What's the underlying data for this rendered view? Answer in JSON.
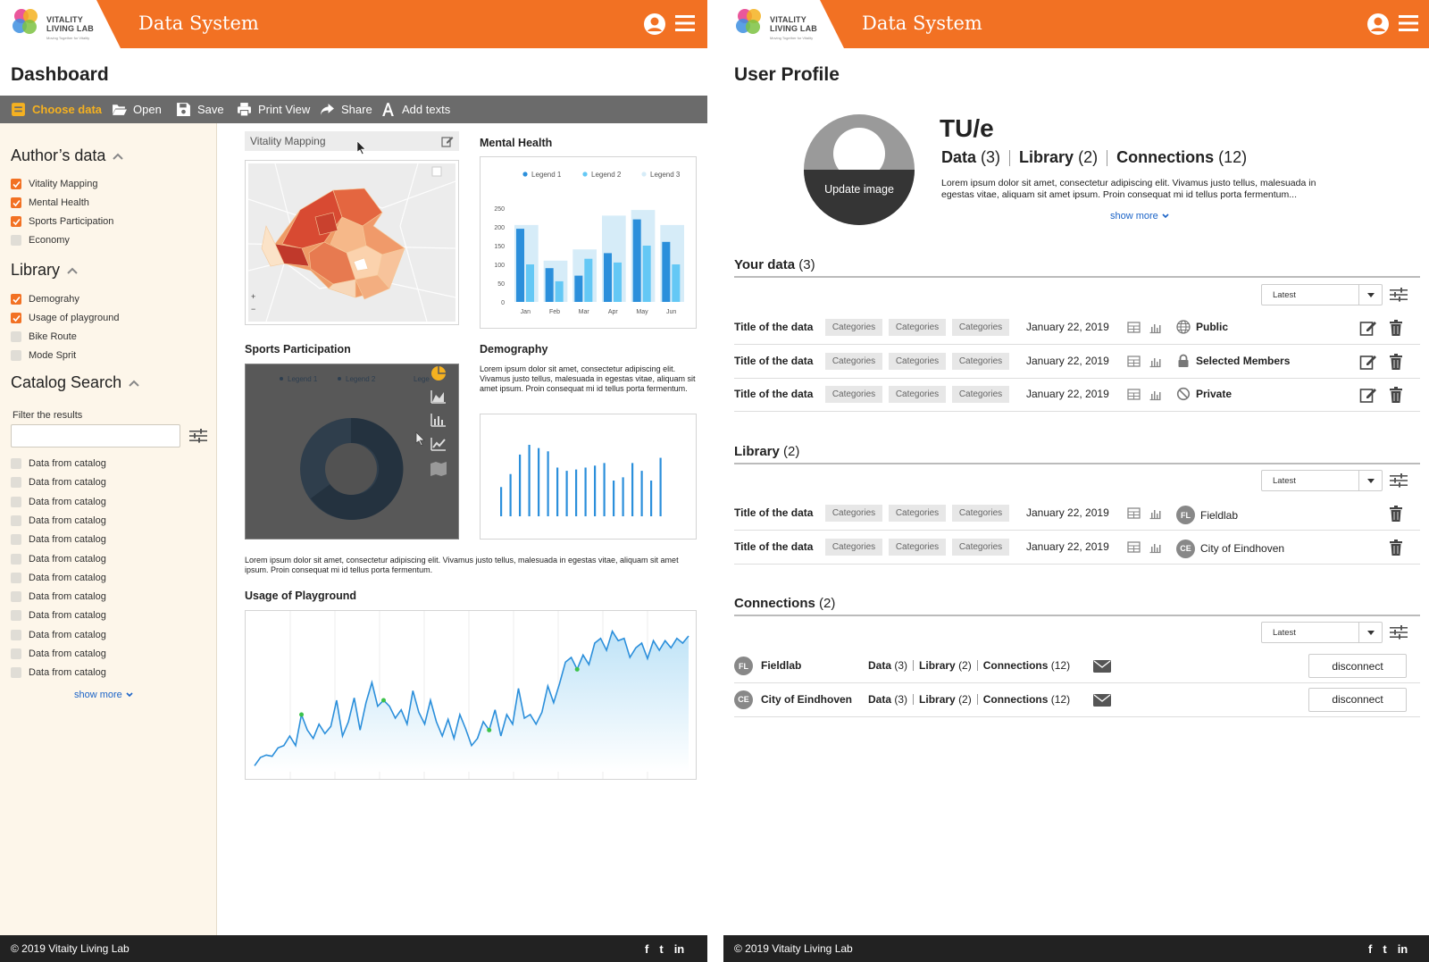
{
  "colors": {
    "brand": "#f27123",
    "toolbar": "#6b6b6b",
    "sidebar": "#fdf6ea",
    "chart_blue": "#2b8fdb",
    "chart_light": "#64c8f5",
    "footer": "#222222",
    "link": "#1a63c7"
  },
  "brand": {
    "logo_line1": "VITALITY",
    "logo_line2": "LIVING LAB",
    "logo_tagline": "Moving Together for Vitality",
    "system_title": "Data System"
  },
  "dashboard": {
    "page_title": "Dashboard",
    "toolbar": {
      "choose_data": "Choose data",
      "open": "Open",
      "save": "Save",
      "print_view": "Print View",
      "share": "Share",
      "add_texts": "Add texts"
    },
    "sidebar": {
      "authors_title": "Author’s data",
      "authors_items": [
        {
          "label": "Vitality Mapping",
          "checked": true
        },
        {
          "label": "Mental Health",
          "checked": true
        },
        {
          "label": "Sports Participation",
          "checked": true
        },
        {
          "label": "Economy",
          "checked": false
        }
      ],
      "library_title": "Library",
      "library_items": [
        {
          "label": "Demograhy",
          "checked": true
        },
        {
          "label": "Usage of playground",
          "checked": true
        },
        {
          "label": "Bike Route",
          "checked": false
        },
        {
          "label": "Mode Sprit",
          "checked": false
        }
      ],
      "catalog_title": "Catalog Search",
      "filter_label": "Filter the results",
      "filter_value": "",
      "catalog_items": [
        "Data from catalog",
        "Data from catalog",
        "Data from catalog",
        "Data from catalog",
        "Data from catalog",
        "Data from catalog",
        "Data from catalog",
        "Data from catalog",
        "Data from catalog",
        "Data from catalog",
        "Data from catalog",
        "Data from catalog"
      ],
      "show_more": "show more"
    },
    "vitality_mapping": {
      "title": "Vitality Mapping",
      "zoom_in": "+",
      "zoom_out": "−"
    },
    "mental_health": {
      "title": "Mental Health",
      "chart_data": {
        "type": "bar",
        "categories": [
          "Jan",
          "Feb",
          "Mar",
          "Apr",
          "May",
          "Jun"
        ],
        "series": [
          {
            "name": "Legend 1",
            "values": [
              195,
              90,
              70,
              130,
              220,
              160
            ]
          },
          {
            "name": "Legend 2",
            "values": [
              100,
              55,
              115,
              105,
              150,
              100
            ]
          },
          {
            "name": "Legend 3",
            "values": [
              205,
              110,
              140,
              230,
              245,
              205
            ]
          }
        ],
        "yticks": [
          "250",
          "200",
          "150",
          "100",
          "50",
          "0"
        ],
        "ylim": [
          0,
          250
        ],
        "legend": "top"
      }
    },
    "sports_participation": {
      "title": "Sports Participation",
      "legend": [
        "Legend 1",
        "Legend 2",
        "Lege"
      ]
    },
    "demography": {
      "title": "Demography",
      "text": "Lorem ipsum dolor sit amet, consectetur adipiscing elit. Vivamus justo tellus, malesuada in egestas vitae, aliquam sit amet ipsum. Proin consequat mi id tellus porta fermentum.",
      "chart_data": {
        "type": "bar",
        "values": [
          45,
          65,
          95,
          110,
          105,
          100,
          75,
          70,
          72,
          75,
          78,
          82,
          55,
          60,
          82,
          70,
          55,
          90
        ]
      }
    },
    "body_text": "Lorem ipsum dolor sit amet, consectetur adipiscing elit. Vivamus justo tellus, malesuada in egestas vitae, aliquam sit amet ipsum. Proin consequat mi id tellus porta fermentum.",
    "usage_of_playground": {
      "title": "Usage of Playground",
      "chart_data": {
        "type": "area",
        "values": [
          5,
          12,
          14,
          13,
          20,
          22,
          30,
          22,
          48,
          35,
          28,
          40,
          32,
          38,
          60,
          30,
          42,
          62,
          35,
          58,
          75,
          55,
          60,
          55,
          45,
          52,
          40,
          68,
          50,
          40,
          60,
          42,
          30,
          44,
          28,
          48,
          36,
          22,
          28,
          42,
          35,
          52,
          30,
          48,
          40,
          70,
          45,
          48,
          40,
          50,
          72,
          58,
          74,
          92,
          96,
          86,
          98,
          90,
          108,
          112,
          102,
          118,
          110,
          112,
          96,
          104,
          108,
          95,
          110,
          102,
          110,
          104,
          112,
          108,
          114
        ]
      }
    },
    "footer": {
      "copyright": "© 2019 Vitaity Living Lab",
      "social": [
        "f",
        "t",
        "in"
      ]
    }
  },
  "profile": {
    "page_title": "User Profile",
    "update_image": "Update image",
    "name": "TU/e",
    "stats": [
      {
        "label": "Data",
        "count": "(3)"
      },
      {
        "label": "Library",
        "count": "(2)"
      },
      {
        "label": "Connections",
        "count": "(12)"
      }
    ],
    "description": "Lorem ipsum dolor sit amet, consectetur adipiscing elit. Vivamus justo tellus, malesuada in egestas vitae, aliquam sit amet ipsum. Proin consequat mi id tellus porta fermentum...",
    "show_more": "show more",
    "your_data": {
      "title": "Your data",
      "count": "(3)",
      "sort": "Latest",
      "rows": [
        {
          "title": "Title of the data",
          "categories": [
            "Categories",
            "Categories",
            "Categories"
          ],
          "date": "January 22, 2019",
          "permission": "Public",
          "perm_icon": "globe-icon"
        },
        {
          "title": "Title of the data",
          "categories": [
            "Categories",
            "Categories",
            "Categories"
          ],
          "date": "January 22, 2019",
          "permission": "Selected Members",
          "perm_icon": "lock-icon"
        },
        {
          "title": "Title of the data",
          "categories": [
            "Categories",
            "Categories",
            "Categories"
          ],
          "date": "January 22, 2019",
          "permission": "Private",
          "perm_icon": "ban-icon"
        }
      ]
    },
    "library": {
      "title": "Library",
      "count": "(2)",
      "sort": "Latest",
      "rows": [
        {
          "title": "Title of the data",
          "categories": [
            "Categories",
            "Categories",
            "Categories"
          ],
          "date": "January 22, 2019",
          "owner_initials": "FL",
          "owner": "Fieldlab"
        },
        {
          "title": "Title of the data",
          "categories": [
            "Categories",
            "Categories",
            "Categories"
          ],
          "date": "January 22, 2019",
          "owner_initials": "CE",
          "owner": "City of Eindhoven"
        }
      ]
    },
    "connections": {
      "title": "Connections",
      "count": "(2)",
      "sort": "Latest",
      "rows": [
        {
          "initials": "FL",
          "name": "Fieldlab",
          "data": "Data",
          "data_count": "(3)",
          "library": "Library",
          "library_count": "(2)",
          "connections": "Connections",
          "connections_count": "(12)",
          "action": "disconnect"
        },
        {
          "initials": "CE",
          "name": "City of Eindhoven",
          "data": "Data",
          "data_count": "(3)",
          "library": "Library",
          "library_count": "(2)",
          "connections": "Connections",
          "connections_count": "(12)",
          "action": "disconnect"
        }
      ]
    },
    "footer": {
      "copyright": "© 2019 Vitaity Living Lab"
    }
  }
}
